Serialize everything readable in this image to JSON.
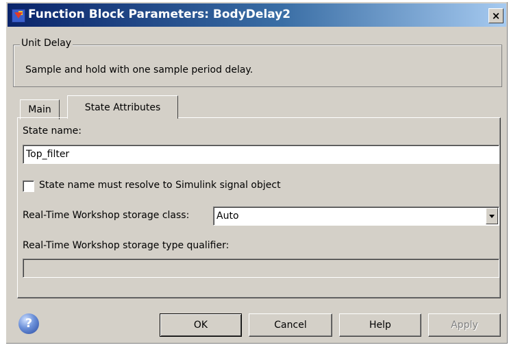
{
  "window": {
    "title": "Function Block Parameters: BodyDelay2",
    "close_label": "×"
  },
  "block": {
    "group_label": "Unit Delay",
    "description": "Sample and hold with one sample period delay."
  },
  "tabs": [
    {
      "label": "Main",
      "active": false
    },
    {
      "label": "State Attributes",
      "active": true
    }
  ],
  "state": {
    "name_label": "State name:",
    "name_value": "Top_filter",
    "resolve_label": "State name must resolve to Simulink signal object",
    "resolve_checked": false,
    "storage_class_label": "Real-Time Workshop storage class:",
    "storage_class_value": "Auto",
    "qualifier_label": "Real-Time Workshop storage type qualifier:",
    "qualifier_value": ""
  },
  "buttons": {
    "help_icon_glyph": "?",
    "ok": "OK",
    "cancel": "Cancel",
    "help": "Help",
    "apply": "Apply"
  },
  "colors": {
    "titlebar_start": "#0a246a",
    "titlebar_end": "#a6caf0",
    "dialog_bg": "#d4d0c8"
  },
  "icons": {
    "window": "simulink-block-icon",
    "help": "question-icon",
    "dropdown": "chevron-down-icon"
  }
}
